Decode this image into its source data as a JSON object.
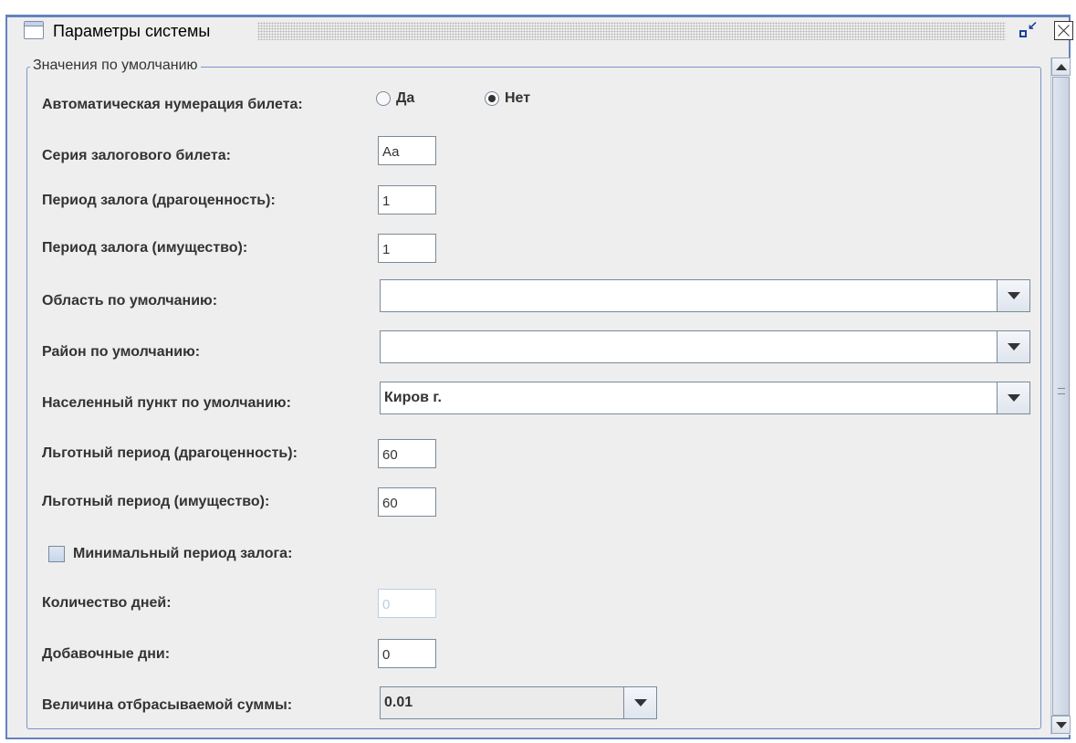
{
  "window": {
    "title": "Параметры системы",
    "restore_icon": "restore-icon",
    "close_icon": "close-icon"
  },
  "group": {
    "title": "Значения по умолчанию"
  },
  "fields": {
    "auto_numbering": {
      "label": "Автоматическая нумерация билета:",
      "option_yes": "Да",
      "option_no": "Нет",
      "selected": "Нет"
    },
    "ticket_series": {
      "label": "Серия залогового билета:",
      "value": "Аа"
    },
    "pledge_period_jewelry": {
      "label": "Период залога (драгоценность):",
      "value": "1"
    },
    "pledge_period_property": {
      "label": "Период залога (имущество):",
      "value": "1"
    },
    "default_region": {
      "label": "Область по умолчанию:",
      "value": ""
    },
    "default_district": {
      "label": "Район по умолчанию:",
      "value": ""
    },
    "default_locality": {
      "label": "Населенный пункт по умолчанию:",
      "value": "Киров г."
    },
    "grace_period_jewelry": {
      "label": "Льготный период (драгоценность):",
      "value": "60"
    },
    "grace_period_property": {
      "label": "Льготный период (имущество):",
      "value": "60"
    },
    "min_pledge_period": {
      "label": "Минимальный период залога:",
      "checked": false
    },
    "days_count": {
      "label": "Количество дней:",
      "value": "0"
    },
    "extra_days": {
      "label": "Добавочные дни:",
      "value": "0"
    },
    "discard_amount": {
      "label": "Величина отбрасываемой суммы:",
      "value": "0.01"
    }
  },
  "colors": {
    "border": "#6382bf",
    "background": "#eeeeee"
  }
}
